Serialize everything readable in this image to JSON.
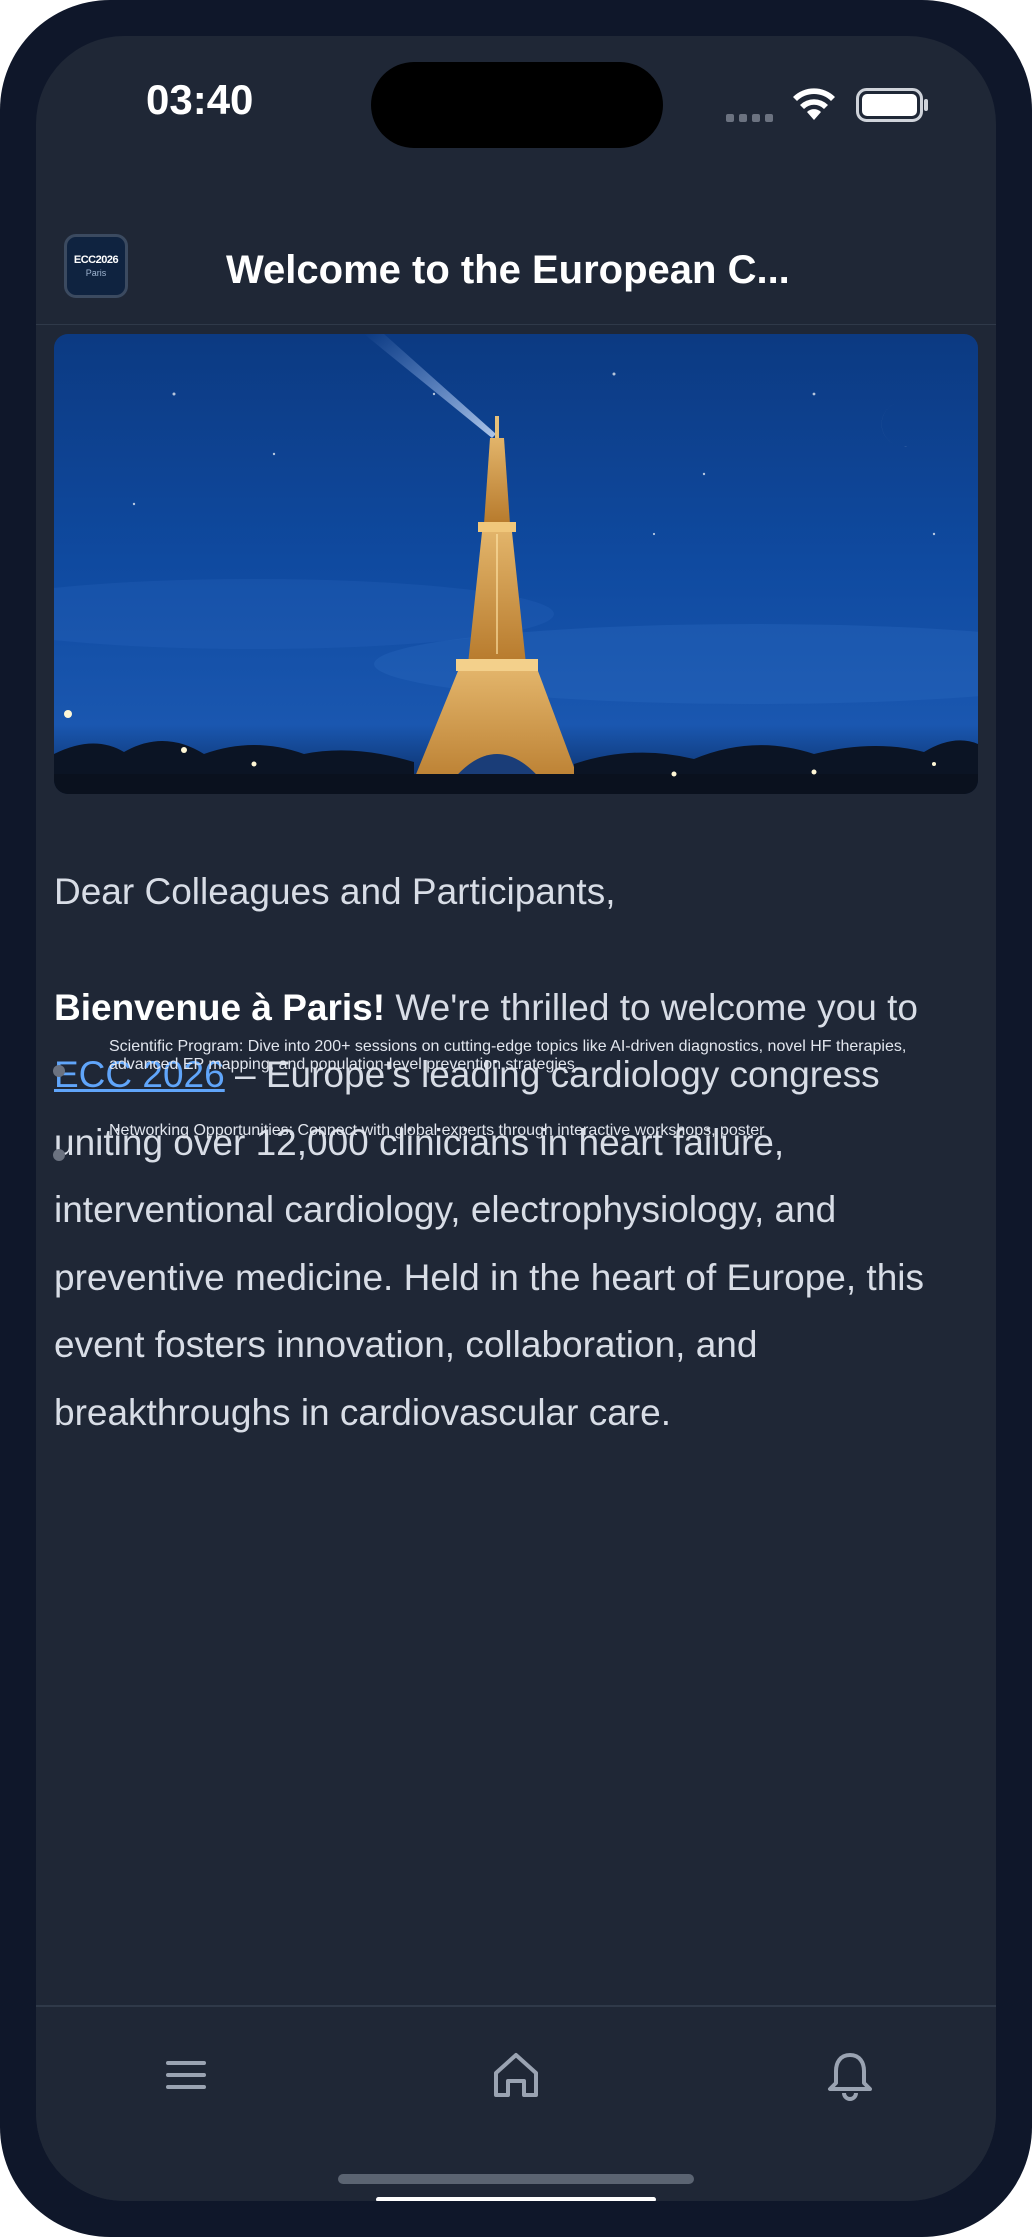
{
  "status_bar": {
    "time": "03:40"
  },
  "header": {
    "logo_line1": "ECC2026",
    "logo_line2": "Paris",
    "title": "Welcome to the European C..."
  },
  "article": {
    "greeting": "Dear Colleagues and Participants,",
    "intro_bold": "Bienvenue à Paris!",
    "intro_text1": " We're thrilled to welcome you to ",
    "intro_link": "ECC 2026",
    "intro_text2": " – Europe's leading cardiology congress uniting over 12,000 clinicians in heart failure, interventional cardiology, electrophysiology, and preventive medicine. Held in the heart of Europe, this event fosters innovation, collaboration, and breakthroughs in cardiovascular care.",
    "bullets": [
      "Scientific Program: Dive into 200+ sessions on cutting-edge topics like AI-driven diagnostics, novel HF therapies, advanced EP mapping, and population-level prevention strategies.",
      "Networking Opportunities: Connect with global experts through interactive workshops, poster"
    ]
  },
  "tabbar": {
    "items": [
      {
        "icon": "menu-icon"
      },
      {
        "icon": "home-icon"
      },
      {
        "icon": "bell-icon"
      }
    ]
  },
  "colors": {
    "background": "#1f2736",
    "link": "#60a5fa",
    "bezel": "#0f172a"
  }
}
